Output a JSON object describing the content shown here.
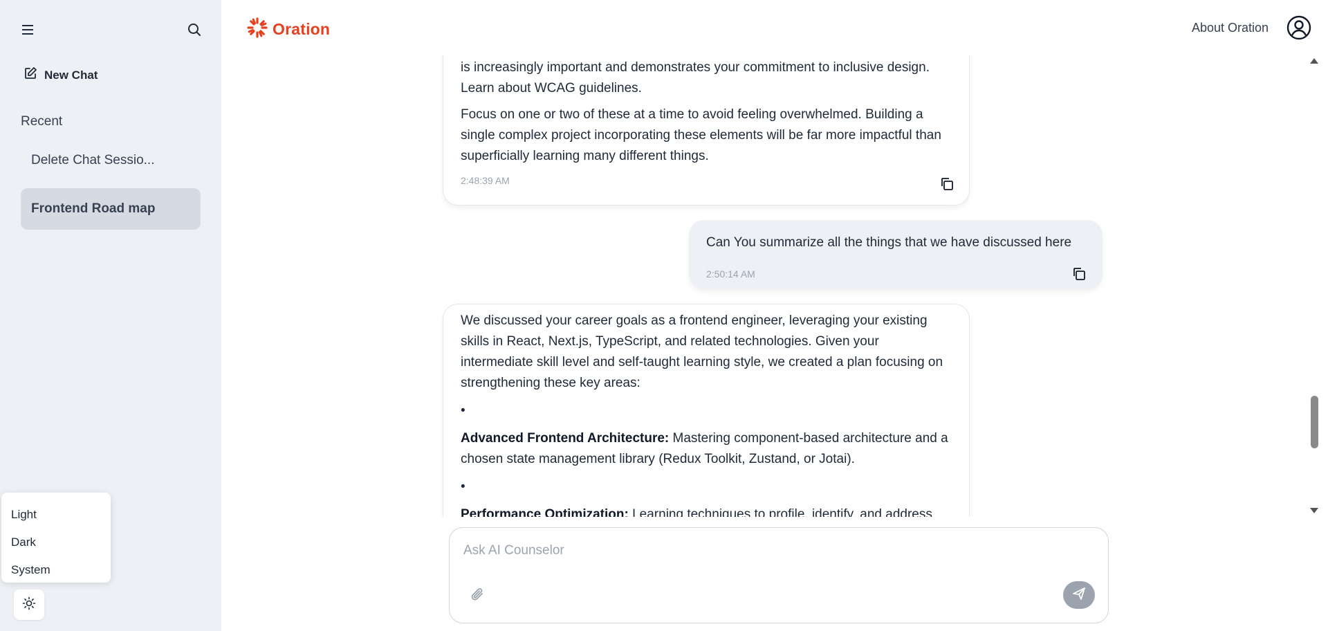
{
  "sidebar": {
    "new_chat_label": "New Chat",
    "recent_label": "Recent",
    "sessions": [
      {
        "label": "Delete Chat Sessio..."
      },
      {
        "label": "Frontend Road map",
        "active": true
      }
    ],
    "theme_menu": {
      "options": [
        "Light",
        "Dark",
        "System"
      ]
    }
  },
  "header": {
    "brand": "Oration",
    "brand_color": "#e5401f",
    "about_link": "About Oration"
  },
  "messages": [
    {
      "role": "assistant",
      "paragraphs": [
        "is increasingly important and demonstrates your commitment to inclusive design. Learn about WCAG guidelines.",
        "Focus on one or two of these at a time to avoid feeling overwhelmed. Building a single complex project incorporating these elements will be far more impactful than superficially learning many different things."
      ],
      "timestamp": "2:48:39 AM"
    },
    {
      "role": "user",
      "text": "Can You summarize all the things that we have discussed here",
      "timestamp": "2:50:14 AM"
    },
    {
      "role": "assistant",
      "intro": "We discussed your career goals as a frontend engineer, leveraging your existing skills in React, Next.js, TypeScript, and related technologies. Given your intermediate skill level and self-taught learning style, we created a plan focusing on strengthening these key areas:",
      "bullets": [
        {
          "title": "Advanced Frontend Architecture:",
          "text": " Mastering component-based architecture and a chosen state management library (Redux Toolkit, Zustand, or Jotai)."
        },
        {
          "title": "Performance Optimization:",
          "text": " Learning techniques to profile, identify, and address"
        }
      ]
    }
  ],
  "composer": {
    "placeholder": "Ask AI Counselor"
  },
  "icons": {
    "menu": "hamburger-menu-icon",
    "search": "search-icon",
    "new_chat": "edit-icon",
    "copy": "copy-icon",
    "attach": "paperclip-icon",
    "send": "send-icon",
    "theme": "sun-icon",
    "avatar": "user-circle-icon"
  }
}
